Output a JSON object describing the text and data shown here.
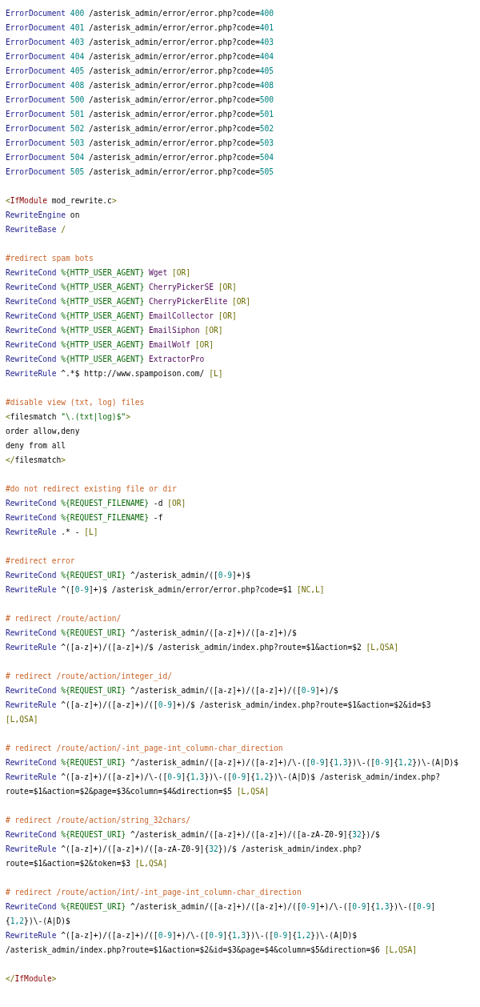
{
  "code_blocks": [
    [
      [
        {
          "kind": "directive",
          "text": "ErrorDocument"
        },
        {
          "kind": "number",
          "text": " 400"
        },
        {
          "kind": "text",
          "text": " /asterisk_admin/error/error.php?code="
        },
        {
          "kind": "number",
          "text": "400"
        }
      ],
      [
        {
          "kind": "directive",
          "text": "ErrorDocument"
        },
        {
          "kind": "number",
          "text": " 401"
        },
        {
          "kind": "text",
          "text": " /asterisk_admin/error/error.php?code="
        },
        {
          "kind": "number",
          "text": "401"
        }
      ],
      [
        {
          "kind": "directive",
          "text": "ErrorDocument"
        },
        {
          "kind": "number",
          "text": " 403"
        },
        {
          "kind": "text",
          "text": " /asterisk_admin/error/error.php?code="
        },
        {
          "kind": "number",
          "text": "403"
        }
      ],
      [
        {
          "kind": "directive",
          "text": "ErrorDocument"
        },
        {
          "kind": "number",
          "text": " 404"
        },
        {
          "kind": "text",
          "text": " /asterisk_admin/error/error.php?code="
        },
        {
          "kind": "number",
          "text": "404"
        }
      ],
      [
        {
          "kind": "directive",
          "text": "ErrorDocument"
        },
        {
          "kind": "number",
          "text": " 405"
        },
        {
          "kind": "text",
          "text": " /asterisk_admin/error/error.php?code="
        },
        {
          "kind": "number",
          "text": "405"
        }
      ],
      [
        {
          "kind": "directive",
          "text": "ErrorDocument"
        },
        {
          "kind": "number",
          "text": " 408"
        },
        {
          "kind": "text",
          "text": " /asterisk_admin/error/error.php?code="
        },
        {
          "kind": "number",
          "text": "408"
        }
      ],
      [
        {
          "kind": "directive",
          "text": "ErrorDocument"
        },
        {
          "kind": "number",
          "text": " 500"
        },
        {
          "kind": "text",
          "text": " /asterisk_admin/error/error.php?code="
        },
        {
          "kind": "number",
          "text": "500"
        }
      ],
      [
        {
          "kind": "directive",
          "text": "ErrorDocument"
        },
        {
          "kind": "number",
          "text": " 501"
        },
        {
          "kind": "text",
          "text": " /asterisk_admin/error/error.php?code="
        },
        {
          "kind": "number",
          "text": "501"
        }
      ],
      [
        {
          "kind": "directive",
          "text": "ErrorDocument"
        },
        {
          "kind": "number",
          "text": " 502"
        },
        {
          "kind": "text",
          "text": " /asterisk_admin/error/error.php?code="
        },
        {
          "kind": "number",
          "text": "502"
        }
      ],
      [
        {
          "kind": "directive",
          "text": "ErrorDocument"
        },
        {
          "kind": "number",
          "text": " 503"
        },
        {
          "kind": "text",
          "text": " /asterisk_admin/error/error.php?code="
        },
        {
          "kind": "number",
          "text": "503"
        }
      ],
      [
        {
          "kind": "directive",
          "text": "ErrorDocument"
        },
        {
          "kind": "number",
          "text": " 504"
        },
        {
          "kind": "text",
          "text": " /asterisk_admin/error/error.php?code="
        },
        {
          "kind": "number",
          "text": "504"
        }
      ],
      [
        {
          "kind": "directive",
          "text": "ErrorDocument"
        },
        {
          "kind": "number",
          "text": " 505"
        },
        {
          "kind": "text",
          "text": " /asterisk_admin/error/error.php?code="
        },
        {
          "kind": "number",
          "text": "505"
        }
      ]
    ],
    [
      [
        {
          "kind": "punct",
          "text": "<"
        },
        {
          "kind": "tag",
          "text": "IfModule"
        },
        {
          "kind": "text",
          "text": " mod_rewrite.c"
        },
        {
          "kind": "punct",
          "text": ">"
        }
      ],
      [
        {
          "kind": "directive",
          "text": "RewriteEngine"
        },
        {
          "kind": "text",
          "text": " on"
        }
      ],
      [
        {
          "kind": "directive",
          "text": "RewriteBase"
        },
        {
          "kind": "punct",
          "text": " /"
        }
      ]
    ],
    [
      [
        {
          "kind": "comment",
          "text": "#redirect spam bots"
        }
      ],
      [
        {
          "kind": "directive",
          "text": "RewriteCond"
        },
        {
          "kind": "variable",
          "text": " %{HTTP_USER_AGENT}"
        },
        {
          "kind": "agent",
          "text": " Wget"
        },
        {
          "kind": "punct",
          "text": " [OR]"
        }
      ],
      [
        {
          "kind": "directive",
          "text": "RewriteCond"
        },
        {
          "kind": "variable",
          "text": " %{HTTP_USER_AGENT}"
        },
        {
          "kind": "agent",
          "text": " CherryPickerSE"
        },
        {
          "kind": "punct",
          "text": " [OR]"
        }
      ],
      [
        {
          "kind": "directive",
          "text": "RewriteCond"
        },
        {
          "kind": "variable",
          "text": " %{HTTP_USER_AGENT}"
        },
        {
          "kind": "agent",
          "text": " CherryPickerElite"
        },
        {
          "kind": "punct",
          "text": " [OR]"
        }
      ],
      [
        {
          "kind": "directive",
          "text": "RewriteCond"
        },
        {
          "kind": "variable",
          "text": " %{HTTP_USER_AGENT}"
        },
        {
          "kind": "agent",
          "text": " EmailCollector"
        },
        {
          "kind": "punct",
          "text": " [OR]"
        }
      ],
      [
        {
          "kind": "directive",
          "text": "RewriteCond"
        },
        {
          "kind": "variable",
          "text": " %{HTTP_USER_AGENT}"
        },
        {
          "kind": "agent",
          "text": " EmailSiphon"
        },
        {
          "kind": "punct",
          "text": " [OR]"
        }
      ],
      [
        {
          "kind": "directive",
          "text": "RewriteCond"
        },
        {
          "kind": "variable",
          "text": " %{HTTP_USER_AGENT}"
        },
        {
          "kind": "agent",
          "text": " EmailWolf"
        },
        {
          "kind": "punct",
          "text": " [OR]"
        }
      ],
      [
        {
          "kind": "directive",
          "text": "RewriteCond"
        },
        {
          "kind": "variable",
          "text": " %{HTTP_USER_AGENT}"
        },
        {
          "kind": "agent",
          "text": " ExtractorPro"
        }
      ],
      [
        {
          "kind": "directive",
          "text": "RewriteRule"
        },
        {
          "kind": "text",
          "text": " ^.*$ http://www.spampoison.com/"
        },
        {
          "kind": "punct",
          "text": " [L]"
        }
      ]
    ],
    [
      [
        {
          "kind": "comment",
          "text": "#disable view (txt, log) files"
        }
      ],
      [
        {
          "kind": "punct",
          "text": "<"
        },
        {
          "kind": "text",
          "text": "filesmatch "
        },
        {
          "kind": "string",
          "text": "\"\\.(txt|log)$\""
        },
        {
          "kind": "punct",
          "text": ">"
        }
      ],
      [
        {
          "kind": "text",
          "text": "order allow,deny"
        }
      ],
      [
        {
          "kind": "text",
          "text": "deny from all"
        }
      ],
      [
        {
          "kind": "punct",
          "text": "</"
        },
        {
          "kind": "text",
          "text": "filesmatch"
        },
        {
          "kind": "punct",
          "text": ">"
        }
      ]
    ],
    [
      [
        {
          "kind": "comment",
          "text": "#do not redirect existing file or dir"
        }
      ],
      [
        {
          "kind": "directive",
          "text": "RewriteCond"
        },
        {
          "kind": "variable",
          "text": " %{REQUEST_FILENAME}"
        },
        {
          "kind": "text",
          "text": " -d"
        },
        {
          "kind": "punct",
          "text": " [OR]"
        }
      ],
      [
        {
          "kind": "directive",
          "text": "RewriteCond"
        },
        {
          "kind": "variable",
          "text": " %{REQUEST_FILENAME}"
        },
        {
          "kind": "text",
          "text": " -f"
        }
      ],
      [
        {
          "kind": "directive",
          "text": "RewriteRule"
        },
        {
          "kind": "text",
          "text": " .* -"
        },
        {
          "kind": "punct",
          "text": " [L]"
        }
      ]
    ],
    [
      [
        {
          "kind": "comment",
          "text": "#redirect error"
        }
      ],
      [
        {
          "kind": "directive",
          "text": "RewriteCond"
        },
        {
          "kind": "variable",
          "text": " %{REQUEST_URI}"
        },
        {
          "kind": "text",
          "text": " ^/asterisk_admin/(["
        },
        {
          "kind": "number",
          "text": "0-9"
        },
        {
          "kind": "text",
          "text": "]+)$"
        }
      ],
      [
        {
          "kind": "directive",
          "text": "RewriteRule"
        },
        {
          "kind": "text",
          "text": " ^(["
        },
        {
          "kind": "number",
          "text": "0-9"
        },
        {
          "kind": "text",
          "text": "]+)$ /asterisk_admin/error/error.php?code=$1"
        },
        {
          "kind": "punct",
          "text": " [NC,L]"
        }
      ]
    ],
    [
      [
        {
          "kind": "comment",
          "text": "# redirect /route/action/"
        }
      ],
      [
        {
          "kind": "directive",
          "text": "RewriteCond"
        },
        {
          "kind": "variable",
          "text": " %{REQUEST_URI}"
        },
        {
          "kind": "text",
          "text": " ^/asterisk_admin/([a-z]+)/([a-z]+)/$"
        }
      ],
      [
        {
          "kind": "directive",
          "text": "RewriteRule"
        },
        {
          "kind": "text",
          "text": " ^([a-z]+)/([a-z]+)/$ /asterisk_admin/index.php?route=$1&action=$2"
        },
        {
          "kind": "punct",
          "text": " [L,QSA]"
        }
      ]
    ],
    [
      [
        {
          "kind": "comment",
          "text": "# redirect /route/action/integer_id/"
        }
      ],
      [
        {
          "kind": "directive",
          "text": "RewriteCond"
        },
        {
          "kind": "variable",
          "text": " %{REQUEST_URI}"
        },
        {
          "kind": "text",
          "text": " ^/asterisk_admin/([a-z]+)/([a-z]+)/(["
        },
        {
          "kind": "number",
          "text": "0-9"
        },
        {
          "kind": "text",
          "text": "]+)/$"
        }
      ],
      [
        {
          "kind": "directive",
          "text": "RewriteRule"
        },
        {
          "kind": "text",
          "text": " ^([a-z]+)/([a-z]+)/(["
        },
        {
          "kind": "number",
          "text": "0-9"
        },
        {
          "kind": "text",
          "text": "]+)/$ /asterisk_admin/index.php?route=$1&action=$2&id=$3"
        },
        {
          "kind": "punct",
          "text": " [L,QSA]"
        }
      ]
    ],
    [
      [
        {
          "kind": "comment",
          "text": "# redirect /route/action/-int_page-int_column-char_direction"
        }
      ],
      [
        {
          "kind": "directive",
          "text": "RewriteCond"
        },
        {
          "kind": "variable",
          "text": " %{REQUEST_URI}"
        },
        {
          "kind": "text",
          "text": " ^/asterisk_admin/([a-z]+)/([a-z]+)/\\-(["
        },
        {
          "kind": "number",
          "text": "0-9"
        },
        {
          "kind": "text",
          "text": "]{"
        },
        {
          "kind": "number",
          "text": "1,3"
        },
        {
          "kind": "text",
          "text": "})\\-(["
        },
        {
          "kind": "number",
          "text": "0-9"
        },
        {
          "kind": "text",
          "text": "]{"
        },
        {
          "kind": "number",
          "text": "1,2"
        },
        {
          "kind": "text",
          "text": "})\\-(A|D)$"
        }
      ],
      [
        {
          "kind": "directive",
          "text": "RewriteRule"
        },
        {
          "kind": "text",
          "text": " ^([a-z]+)/([a-z]+)/\\-(["
        },
        {
          "kind": "number",
          "text": "0-9"
        },
        {
          "kind": "text",
          "text": "]{"
        },
        {
          "kind": "number",
          "text": "1,3"
        },
        {
          "kind": "text",
          "text": "})\\-(["
        },
        {
          "kind": "number",
          "text": "0-9"
        },
        {
          "kind": "text",
          "text": "]{"
        },
        {
          "kind": "number",
          "text": "1,2"
        },
        {
          "kind": "text",
          "text": "})\\-(A|D)$ /asterisk_admin/index.php?route=$1&action=$2&page=$3&column=$4&direction=$5"
        },
        {
          "kind": "punct",
          "text": " [L,QSA]"
        }
      ]
    ],
    [
      [
        {
          "kind": "comment",
          "text": "# redirect /route/action/string_32chars/"
        }
      ],
      [
        {
          "kind": "directive",
          "text": "RewriteCond"
        },
        {
          "kind": "variable",
          "text": " %{REQUEST_URI}"
        },
        {
          "kind": "text",
          "text": " ^/asterisk_admin/([a-z]+)/([a-z]+)/([a-zA-Z0-9]{"
        },
        {
          "kind": "number",
          "text": "32"
        },
        {
          "kind": "text",
          "text": "})/$"
        }
      ],
      [
        {
          "kind": "directive",
          "text": "RewriteRule"
        },
        {
          "kind": "text",
          "text": " ^([a-z]+)/([a-z]+)/([a-zA-Z0-9]{"
        },
        {
          "kind": "number",
          "text": "32"
        },
        {
          "kind": "text",
          "text": "})/$ /asterisk_admin/index.php?route=$1&action=$2&token=$3"
        },
        {
          "kind": "punct",
          "text": " [L,QSA]"
        }
      ]
    ],
    [
      [
        {
          "kind": "comment",
          "text": "# redirect /route/action/int/-int_page-int_column-char_direction"
        }
      ],
      [
        {
          "kind": "directive",
          "text": "RewriteCond"
        },
        {
          "kind": "variable",
          "text": " %{REQUEST_URI}"
        },
        {
          "kind": "text",
          "text": " ^/asterisk_admin/([a-z]+)/([a-z]+)/(["
        },
        {
          "kind": "number",
          "text": "0-9"
        },
        {
          "kind": "text",
          "text": "]+)/\\-(["
        },
        {
          "kind": "number",
          "text": "0-9"
        },
        {
          "kind": "text",
          "text": "]{"
        },
        {
          "kind": "number",
          "text": "1,3"
        },
        {
          "kind": "text",
          "text": "})\\-(["
        },
        {
          "kind": "number",
          "text": "0-9"
        },
        {
          "kind": "text",
          "text": "]{"
        },
        {
          "kind": "number",
          "text": "1,2"
        },
        {
          "kind": "text",
          "text": "})\\-(A|D)$"
        }
      ],
      [
        {
          "kind": "directive",
          "text": "RewriteRule"
        },
        {
          "kind": "text",
          "text": " ^([a-z]+)/([a-z]+)/(["
        },
        {
          "kind": "number",
          "text": "0-9"
        },
        {
          "kind": "text",
          "text": "]+)/\\-(["
        },
        {
          "kind": "number",
          "text": "0-9"
        },
        {
          "kind": "text",
          "text": "]{"
        },
        {
          "kind": "number",
          "text": "1,3"
        },
        {
          "kind": "text",
          "text": "})\\-(["
        },
        {
          "kind": "number",
          "text": "0-9"
        },
        {
          "kind": "text",
          "text": "]{"
        },
        {
          "kind": "number",
          "text": "1,2"
        },
        {
          "kind": "text",
          "text": "})\\-(A|D)$ /asterisk_admin/index.php?route=$1&action=$2&id=$3&page=$4&column=$5&direction=$6"
        },
        {
          "kind": "punct",
          "text": " [L,QSA]"
        }
      ]
    ],
    [
      [
        {
          "kind": "punct",
          "text": "</"
        },
        {
          "kind": "tag",
          "text": "IfModule"
        },
        {
          "kind": "punct",
          "text": ">"
        }
      ]
    ]
  ]
}
